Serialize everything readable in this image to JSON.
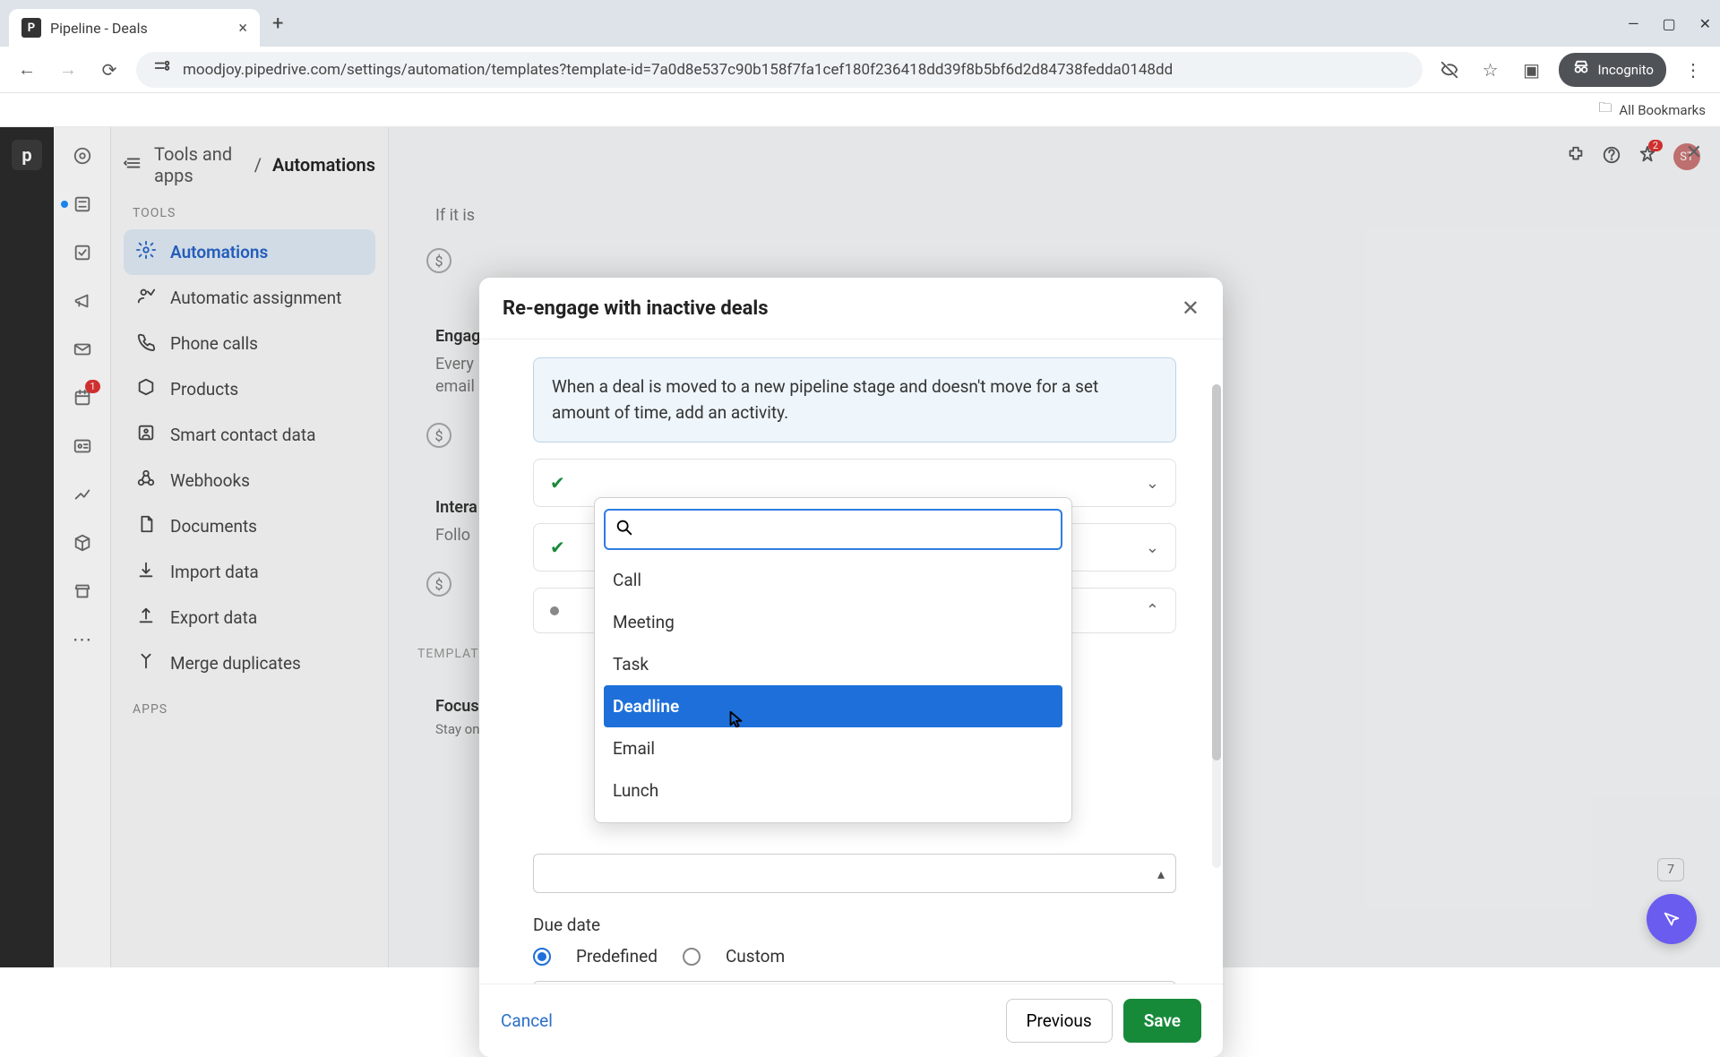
{
  "browser": {
    "tab_title": "Pipeline - Deals",
    "favicon_letter": "P",
    "url": "moodjoy.pipedrive.com/settings/automation/templates?template-id=7a0d8e537c90b158f7fa1cef180f236418dd39f8b5bf6d2d84738fedda0148dd",
    "incognito_label": "Incognito",
    "bookmarks_label": "All Bookmarks"
  },
  "header": {
    "breadcrumb_root": "Tools and apps",
    "breadcrumb_current": "Automations",
    "avatar_initials": "ST",
    "alert_count": "2"
  },
  "rail_badge": "1",
  "sidebar": {
    "section_tools": "TOOLS",
    "section_apps": "APPS",
    "items": [
      {
        "label": "Automations"
      },
      {
        "label": "Automatic assignment"
      },
      {
        "label": "Phone calls"
      },
      {
        "label": "Products"
      },
      {
        "label": "Smart contact data"
      },
      {
        "label": "Webhooks"
      },
      {
        "label": "Documents"
      },
      {
        "label": "Import data"
      },
      {
        "label": "Export data"
      },
      {
        "label": "Merge duplicates"
      }
    ]
  },
  "background": {
    "line1": "If it is",
    "engage_title": "Engag",
    "engage_sub1": "Every",
    "engage_sub2": "email",
    "intera_title": "Intera",
    "follow": "Follo",
    "templates_label": "TEMPLAT",
    "focus_title": "Focus",
    "focus_sub": "Stay on",
    "count": "7"
  },
  "modal": {
    "title": "Re-engage with inactive deals",
    "info": "When a deal is moved to a new pipeline stage and doesn't move for a set amount of time, add an activity.",
    "dropdown": {
      "search_placeholder": "",
      "options": [
        {
          "label": "Call"
        },
        {
          "label": "Meeting"
        },
        {
          "label": "Task"
        },
        {
          "label": "Deadline"
        },
        {
          "label": "Email"
        },
        {
          "label": "Lunch"
        }
      ],
      "selected_index": 3
    },
    "due_date_label": "Due date",
    "radio_predefined": "Predefined",
    "radio_custom": "Custom",
    "cancel": "Cancel",
    "previous": "Previous",
    "save": "Save"
  }
}
